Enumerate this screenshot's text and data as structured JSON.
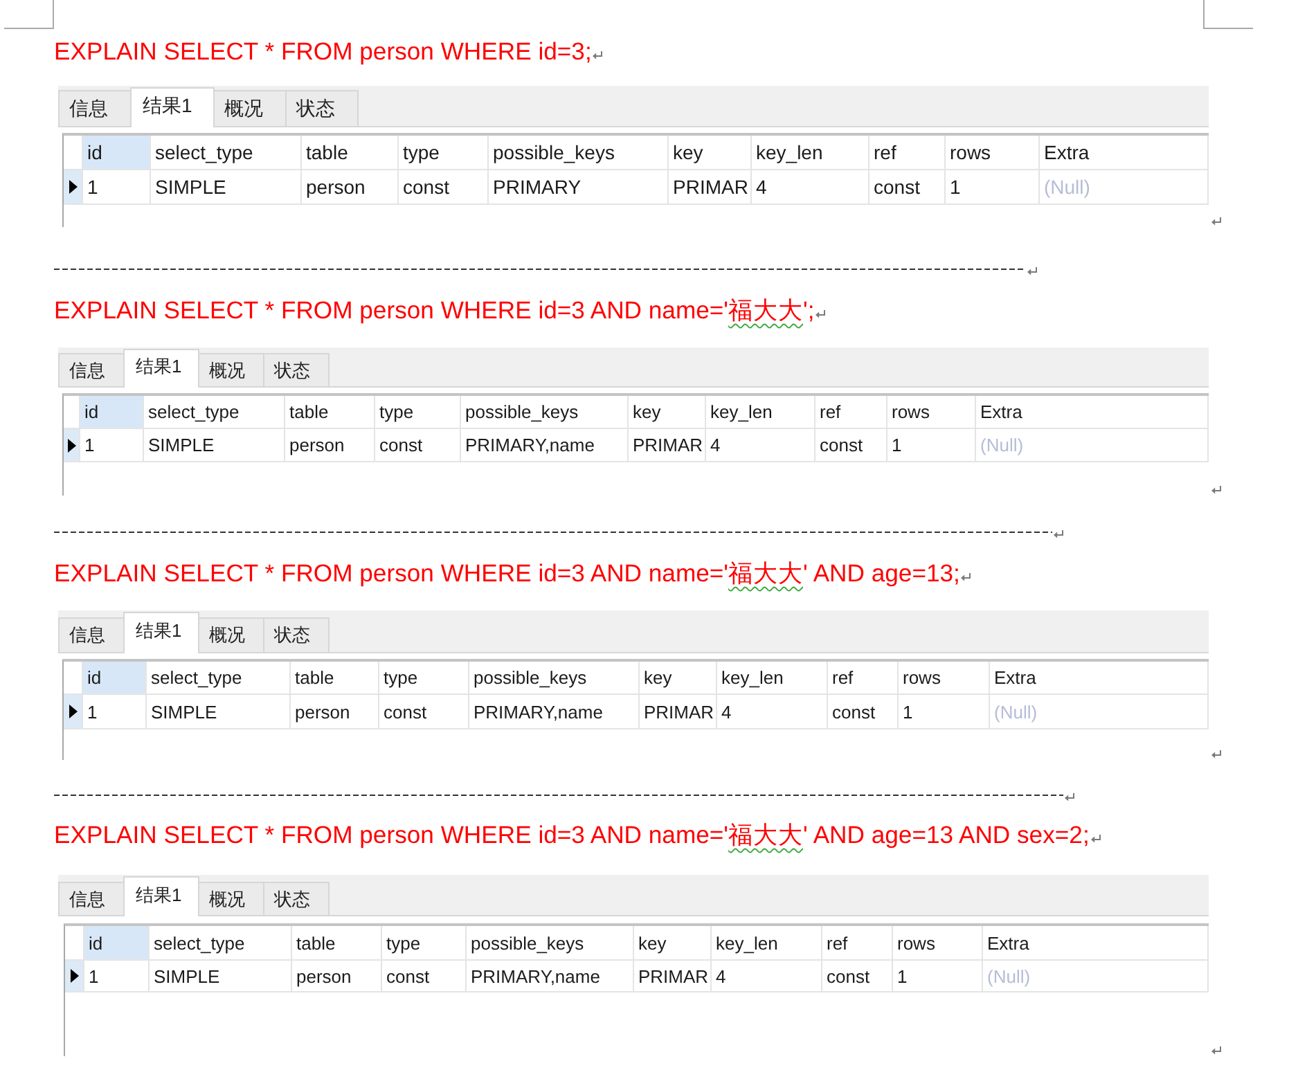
{
  "blocks": [
    {
      "query": [
        {
          "text": "EXPLAIN SELECT * FROM person WHERE id=3;",
          "spelling_flagged": false
        }
      ],
      "result": {
        "tabs": [
          {
            "label": "信息",
            "selected": false
          },
          {
            "label": "结果1",
            "selected": true
          },
          {
            "label": "概况",
            "selected": false
          },
          {
            "label": "状态",
            "selected": false
          }
        ],
        "columns": [
          {
            "label": "id",
            "highlighted": true
          },
          {
            "label": "select_type",
            "highlighted": false
          },
          {
            "label": "table",
            "highlighted": false
          },
          {
            "label": "type",
            "highlighted": false
          },
          {
            "label": "possible_keys",
            "highlighted": false
          },
          {
            "label": "key",
            "highlighted": false
          },
          {
            "label": "key_len",
            "highlighted": false
          },
          {
            "label": "ref",
            "highlighted": false
          },
          {
            "label": "rows",
            "highlighted": false
          },
          {
            "label": "Extra",
            "highlighted": false
          }
        ],
        "rows": [
          {
            "current": true,
            "cells": [
              {
                "text": "1",
                "is_null": false
              },
              {
                "text": "SIMPLE",
                "is_null": false
              },
              {
                "text": "person",
                "is_null": false
              },
              {
                "text": "const",
                "is_null": false
              },
              {
                "text": "PRIMARY",
                "is_null": false
              },
              {
                "text": "PRIMAR",
                "is_null": false
              },
              {
                "text": "4",
                "is_null": false
              },
              {
                "text": "const",
                "is_null": false
              },
              {
                "text": "1",
                "is_null": false
              },
              {
                "text": "(Null)",
                "is_null": true
              }
            ]
          }
        ]
      }
    },
    {
      "query": [
        {
          "text": "EXPLAIN SELECT * FROM person WHERE id=3 AND name='",
          "spelling_flagged": false
        },
        {
          "text": "福大大",
          "spelling_flagged": true
        },
        {
          "text": "';",
          "spelling_flagged": false
        }
      ],
      "result": {
        "tabs": [
          {
            "label": "信息",
            "selected": false
          },
          {
            "label": "结果1",
            "selected": true
          },
          {
            "label": "概况",
            "selected": false
          },
          {
            "label": "状态",
            "selected": false
          }
        ],
        "columns": [
          {
            "label": "id",
            "highlighted": true
          },
          {
            "label": "select_type",
            "highlighted": false
          },
          {
            "label": "table",
            "highlighted": false
          },
          {
            "label": "type",
            "highlighted": false
          },
          {
            "label": "possible_keys",
            "highlighted": false
          },
          {
            "label": "key",
            "highlighted": false
          },
          {
            "label": "key_len",
            "highlighted": false
          },
          {
            "label": "ref",
            "highlighted": false
          },
          {
            "label": "rows",
            "highlighted": false
          },
          {
            "label": "Extra",
            "highlighted": false
          }
        ],
        "rows": [
          {
            "current": true,
            "cells": [
              {
                "text": "1",
                "is_null": false
              },
              {
                "text": "SIMPLE",
                "is_null": false
              },
              {
                "text": "person",
                "is_null": false
              },
              {
                "text": "const",
                "is_null": false
              },
              {
                "text": "PRIMARY,name",
                "is_null": false
              },
              {
                "text": "PRIMAR",
                "is_null": false
              },
              {
                "text": "4",
                "is_null": false
              },
              {
                "text": "const",
                "is_null": false
              },
              {
                "text": "1",
                "is_null": false
              },
              {
                "text": "(Null)",
                "is_null": true
              }
            ]
          }
        ]
      }
    },
    {
      "query": [
        {
          "text": "EXPLAIN SELECT * FROM person WHERE id=3 AND name='",
          "spelling_flagged": false
        },
        {
          "text": "福大大",
          "spelling_flagged": true
        },
        {
          "text": "' AND age=13;",
          "spelling_flagged": false
        }
      ],
      "result": {
        "tabs": [
          {
            "label": "信息",
            "selected": false
          },
          {
            "label": "结果1",
            "selected": true
          },
          {
            "label": "概况",
            "selected": false
          },
          {
            "label": "状态",
            "selected": false
          }
        ],
        "columns": [
          {
            "label": "id",
            "highlighted": true
          },
          {
            "label": "select_type",
            "highlighted": false
          },
          {
            "label": "table",
            "highlighted": false
          },
          {
            "label": "type",
            "highlighted": false
          },
          {
            "label": "possible_keys",
            "highlighted": false
          },
          {
            "label": "key",
            "highlighted": false
          },
          {
            "label": "key_len",
            "highlighted": false
          },
          {
            "label": "ref",
            "highlighted": false
          },
          {
            "label": "rows",
            "highlighted": false
          },
          {
            "label": "Extra",
            "highlighted": false
          }
        ],
        "rows": [
          {
            "current": true,
            "cells": [
              {
                "text": "1",
                "is_null": false
              },
              {
                "text": "SIMPLE",
                "is_null": false
              },
              {
                "text": "person",
                "is_null": false
              },
              {
                "text": "const",
                "is_null": false
              },
              {
                "text": "PRIMARY,name",
                "is_null": false
              },
              {
                "text": "PRIMAR",
                "is_null": false
              },
              {
                "text": "4",
                "is_null": false
              },
              {
                "text": "const",
                "is_null": false
              },
              {
                "text": "1",
                "is_null": false
              },
              {
                "text": "(Null)",
                "is_null": true
              }
            ]
          }
        ]
      }
    },
    {
      "query": [
        {
          "text": "EXPLAIN SELECT * FROM person WHERE id=3 AND name='",
          "spelling_flagged": false
        },
        {
          "text": "福大大",
          "spelling_flagged": true
        },
        {
          "text": "' AND age=13 AND sex=2;",
          "spelling_flagged": false
        }
      ],
      "result": {
        "tabs": [
          {
            "label": "信息",
            "selected": false
          },
          {
            "label": "结果1",
            "selected": true
          },
          {
            "label": "概况",
            "selected": false
          },
          {
            "label": "状态",
            "selected": false
          }
        ],
        "columns": [
          {
            "label": "id",
            "highlighted": true
          },
          {
            "label": "select_type",
            "highlighted": false
          },
          {
            "label": "table",
            "highlighted": false
          },
          {
            "label": "type",
            "highlighted": false
          },
          {
            "label": "possible_keys",
            "highlighted": false
          },
          {
            "label": "key",
            "highlighted": false
          },
          {
            "label": "key_len",
            "highlighted": false
          },
          {
            "label": "ref",
            "highlighted": false
          },
          {
            "label": "rows",
            "highlighted": false
          },
          {
            "label": "Extra",
            "highlighted": false
          }
        ],
        "rows": [
          {
            "current": true,
            "cells": [
              {
                "text": "1",
                "is_null": false
              },
              {
                "text": "SIMPLE",
                "is_null": false
              },
              {
                "text": "person",
                "is_null": false
              },
              {
                "text": "const",
                "is_null": false
              },
              {
                "text": "PRIMARY,name",
                "is_null": false
              },
              {
                "text": "PRIMAR",
                "is_null": false
              },
              {
                "text": "4",
                "is_null": false
              },
              {
                "text": "const",
                "is_null": false
              },
              {
                "text": "1",
                "is_null": false
              },
              {
                "text": "(Null)",
                "is_null": true
              }
            ]
          }
        ]
      }
    }
  ]
}
